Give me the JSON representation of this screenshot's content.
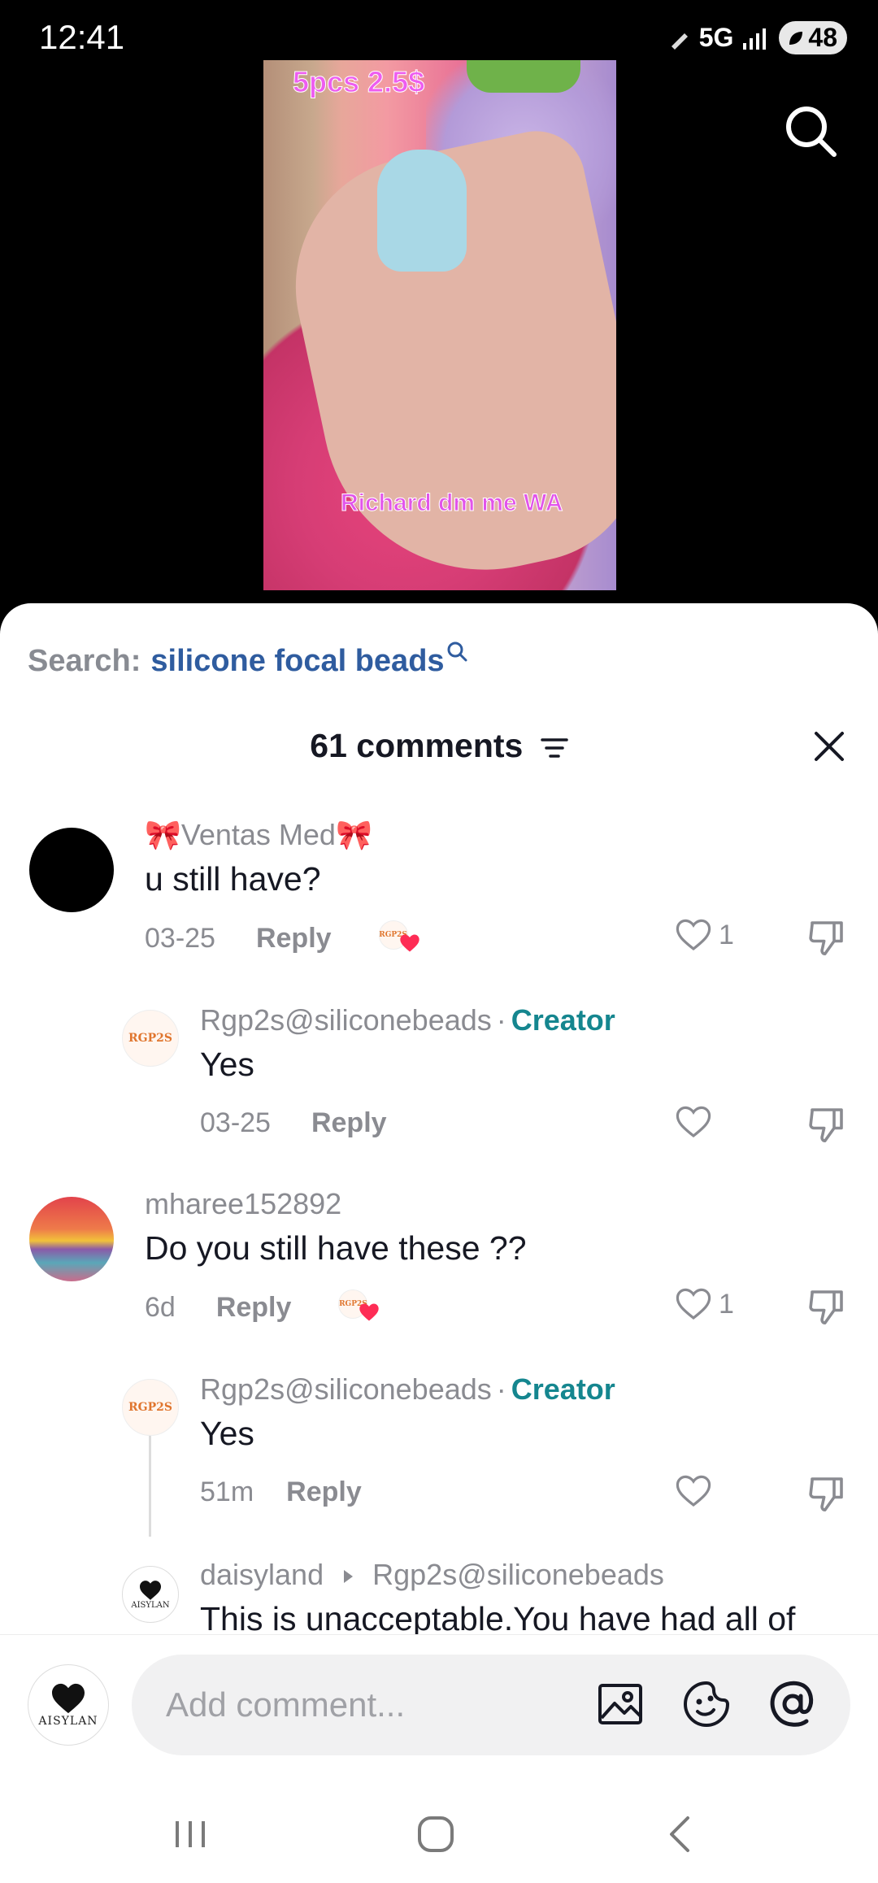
{
  "status_bar": {
    "time": "12:41",
    "network": "5G",
    "battery": "48"
  },
  "video": {
    "caption_top": "5pcs 2.5$",
    "caption_bottom": "Richard dm me WA"
  },
  "sheet": {
    "search_label": "Search:",
    "search_term": "silicone focal beads",
    "comment_count": "61 comments"
  },
  "comments": [
    {
      "user": "🎀Ventas Med🎀",
      "text": "u still have?",
      "date": "03-25",
      "reply": "Reply",
      "likes": "1"
    },
    {
      "user": "Rgp2s@siliconebeads",
      "separator": "·",
      "badge": "Creator",
      "text": "Yes",
      "date": "03-25",
      "reply": "Reply"
    },
    {
      "user": "mharee152892",
      "text": "Do you still have these ??",
      "date": "6d",
      "reply": "Reply",
      "likes": "1"
    },
    {
      "user": "Rgp2s@siliconebeads",
      "separator": "·",
      "badge": "Creator",
      "text": "Yes",
      "date": "51m",
      "reply": "Reply"
    },
    {
      "user": "daisyland",
      "reply_to": "Rgp2s@siliconebeads",
      "text": "This is unacceptable.You have had all of"
    }
  ],
  "avatars": {
    "creator_avatar_text": "RGP2S",
    "aisylan_text": "AISYLAN"
  },
  "composer": {
    "placeholder": "Add comment..."
  },
  "icons": {
    "search": "search-icon",
    "close": "close-icon",
    "filter": "filter-icon",
    "heart": "heart-icon",
    "dislike": "dislike-icon",
    "image": "image-icon",
    "sticker": "sticker-icon",
    "mention": "at-icon"
  },
  "colors": {
    "creator_badge": "#15868f",
    "search_term": "#2f5c9f",
    "muted": "#8a8b91"
  }
}
